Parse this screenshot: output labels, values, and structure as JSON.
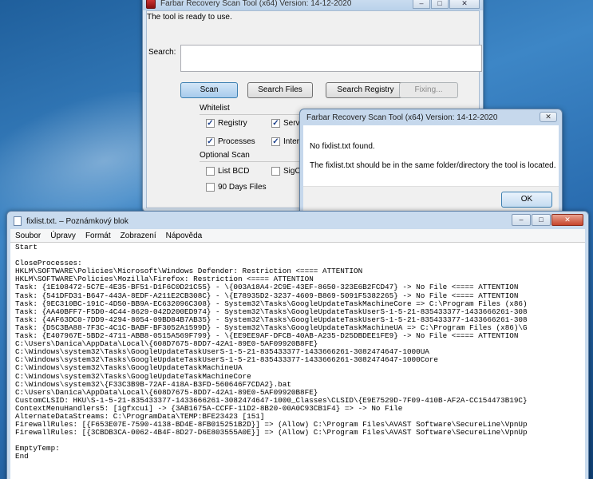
{
  "frst": {
    "title": "Farbar Recovery Scan Tool (x64) Version: 14-12-2020",
    "status": "The tool is ready to use.",
    "search_label": "Search:",
    "search_value": "",
    "buttons": {
      "scan": "Scan",
      "search_files": "Search Files",
      "search_registry": "Search Registry",
      "fixing": "Fixing..."
    },
    "whitelist_label": "Whitelist",
    "whitelist": {
      "registry": "Registry",
      "services": "Service",
      "processes": "Processes",
      "internet": "Interne"
    },
    "optional_label": "Optional Scan",
    "optional": {
      "list_bcd": "List BCD",
      "sigcheck": "SigChe",
      "ninety_days": "90 Days Files"
    }
  },
  "dialog": {
    "title": "Farbar Recovery Scan Tool (x64) Version: 14-12-2020",
    "message1": "No fixlist.txt found.",
    "message2": "The fixlist.txt should be in the same folder/directory the tool is located.",
    "ok_label": "OK"
  },
  "notepad": {
    "title": "fixlist.txt. – Poznámkový blok",
    "menu": [
      "Soubor",
      "Úpravy",
      "Formát",
      "Zobrazení",
      "Nápověda"
    ],
    "lines": [
      "Start",
      "",
      "CloseProcesses:",
      "HKLM\\SOFTWARE\\Policies\\Microsoft\\Windows Defender: Restriction <==== ATTENTION",
      "HKLM\\SOFTWARE\\Policies\\Mozilla\\Firefox: Restriction <==== ATTENTION",
      "Task: {1E108472-5C7E-4E35-BF51-D1F6C0D21C55} - \\{003A18A4-2C9E-43EF-8650-323E6B2FCD47} -> No File <==== ATTENTION",
      "Task: {541DFD31-B647-443A-8EDF-A211E2CB308C} - \\{E78935D2-3237-4609-B869-5091F5382265} -> No File <==== ATTENTION",
      "Task: {9EC310BC-191C-4D50-BB9A-EC632096C308} - System32\\Tasks\\GoogleUpdateTaskMachineCore => C:\\Program Files (x86)",
      "Task: {AA40BFF7-F5D0-4C44-8629-042D200ED974} - System32\\Tasks\\GoogleUpdateTaskUserS-1-5-21-835433377-1433666261-308",
      "Task: {4AF63DC0-7DD9-4294-8054-09BD84B7AB35} - System32\\Tasks\\GoogleUpdateTaskUserS-1-5-21-835433377-1433666261-308",
      "Task: {D5C3BA88-7F3C-4C1C-BABF-BF3052A1599D} - System32\\Tasks\\GoogleUpdateTaskMachineUA => C:\\Program Files (x86)\\G",
      "Task: {E407967E-5BD2-4711-ABB8-0515A569F799} - \\{EE9EE9AF-DFCB-40AB-A235-D25DBDEE1FE9} -> No File <==== ATTENTION",
      "C:\\Users\\Danica\\AppData\\Local\\{608D7675-8DD7-42A1-89E0-5AF09920B8FE}",
      "C:\\Windows\\system32\\Tasks\\GoogleUpdateTaskUserS-1-5-21-835433377-1433666261-3082474647-1000UA",
      "C:\\Windows\\system32\\Tasks\\GoogleUpdateTaskUserS-1-5-21-835433377-1433666261-3082474647-1000Core",
      "C:\\Windows\\system32\\Tasks\\GoogleUpdateTaskMachineUA",
      "C:\\Windows\\system32\\Tasks\\GoogleUpdateTaskMachineCore",
      "C:\\Windows\\system32\\{F33C3B9B-72AF-418A-B3FD-560646F7CDA2}.bat",
      "C:\\Users\\Danica\\AppData\\Local\\{608D7675-8DD7-42A1-89E0-5AF09920B8FE}",
      "CustomCLSID: HKU\\S-1-5-21-835433377-1433666261-3082474647-1000_Classes\\CLSID\\{E9E7529D-7F09-410B-AF2A-CC154473B19C}",
      "ContextMenuHandlers5: [igfxcui] -> {3AB1675A-CCFF-11D2-8B20-00A0C93CB1F4} => -> No File",
      "AlternateDataStreams: C:\\ProgramData\\TEMP:BFE23423 [151]",
      "FirewallRules: [{F653E07E-7590-4138-BD4E-8FB015251B2D}] => (Allow) C:\\Program Files\\AVAST Software\\SecureLine\\VpnUp",
      "FirewallRules: [{3CBDB3CA-0062-4B4F-8D27-D6E803555A0E}] => (Allow) C:\\Program Files\\AVAST Software\\SecureLine\\VpnUp",
      "",
      "EmptyTemp:",
      "End"
    ]
  }
}
